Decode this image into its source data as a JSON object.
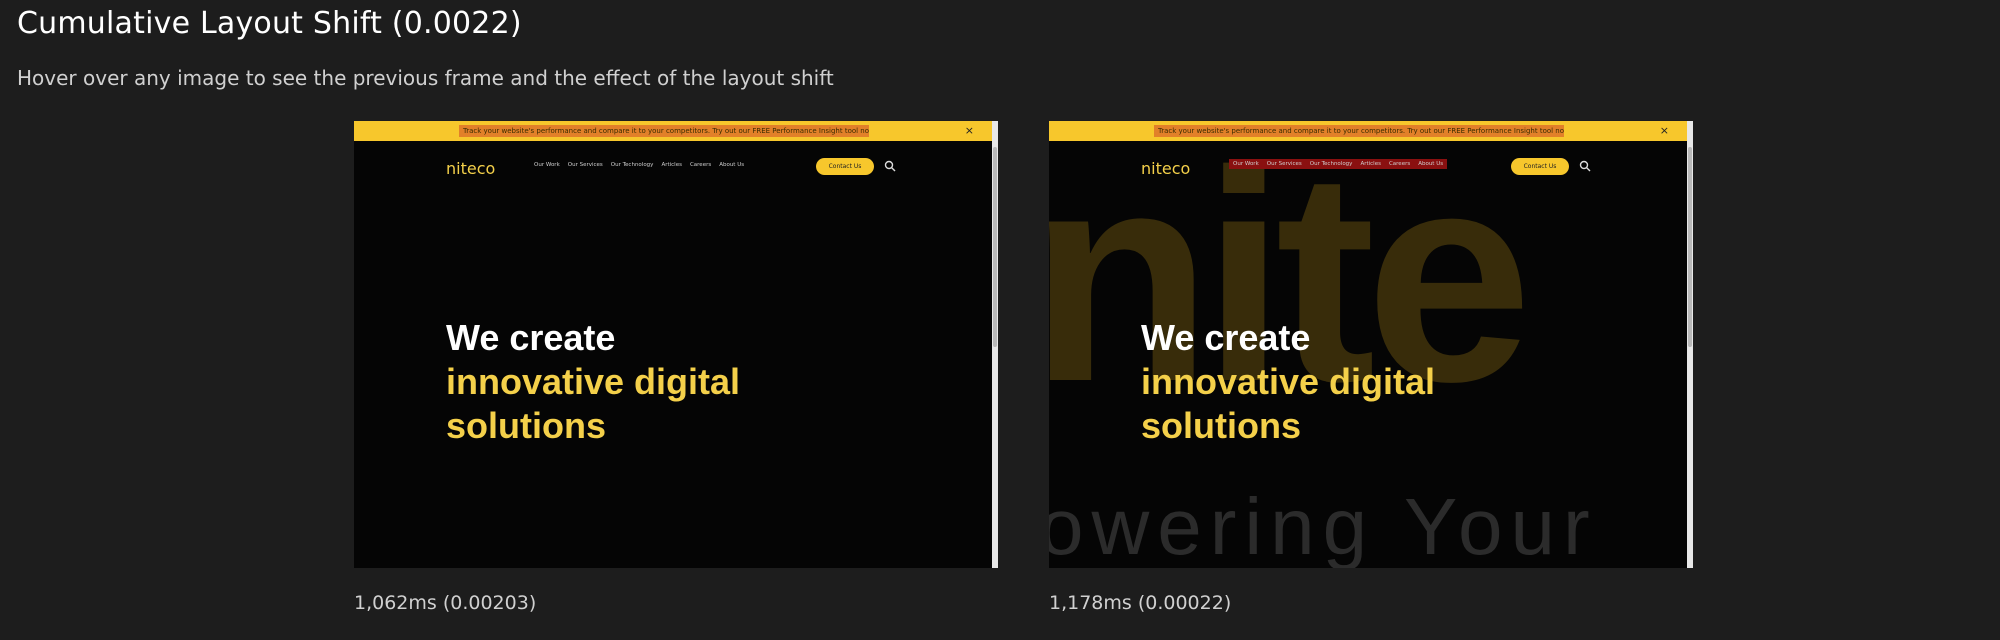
{
  "header": {
    "title": "Cumulative Layout Shift (0.0022)",
    "subtitle": "Hover over any image to see the previous frame and the effect of the layout shift"
  },
  "frames": [
    {
      "caption": "1,062ms (0.00203)",
      "banner_text": "Track your website's performance and compare it to your competitors. Try out our FREE Performance Insight tool now! Start up →",
      "banner_close": "×",
      "logo": "niteco",
      "nav": [
        "Our Work",
        "Our Services",
        "Our Technology",
        "Articles",
        "Careers",
        "About Us"
      ],
      "contact_label": "Contact Us",
      "hero": [
        "We create",
        "innovative digital",
        "solutions"
      ]
    },
    {
      "caption": "1,178ms (0.00022)",
      "banner_text": "Track your website's performance and compare it to your competitors. Try out our FREE Performance Insight tool now! Start up →",
      "banner_close": "×",
      "logo": "niteco",
      "nav": [
        "Our Work",
        "Our Services",
        "Our Technology",
        "Articles",
        "Careers",
        "About Us"
      ],
      "contact_label": "Contact Us",
      "hero": [
        "We create",
        "innovative digital",
        "solutions"
      ],
      "background_text": "nite",
      "background_subtext": "owering Your"
    }
  ],
  "colors": {
    "page_background": "#1d1d1d",
    "banner": "#f7c72c",
    "brand_yellow": "#f4d04a",
    "hero_white": "#ffffff"
  },
  "icons": {
    "search": "search-icon",
    "close": "close-icon"
  }
}
